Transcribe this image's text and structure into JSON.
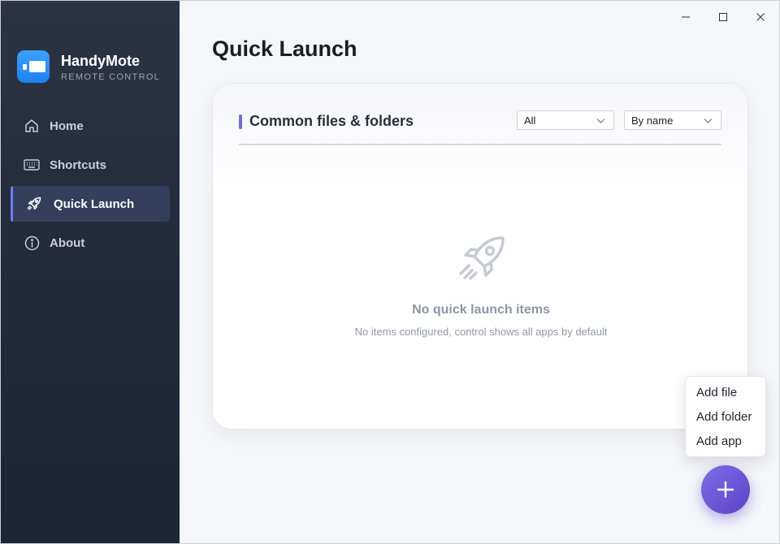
{
  "brand": {
    "name": "HandyMote",
    "subtitle": "REMOTE CONTROL",
    "icon": "remote-logo-icon",
    "accent": "#2a90f8"
  },
  "nav": {
    "items": [
      {
        "label": "Home",
        "icon": "home-icon",
        "active": false
      },
      {
        "label": "Shortcuts",
        "icon": "keyboard-icon",
        "active": false
      },
      {
        "label": "Quick Launch",
        "icon": "rocket-icon",
        "active": true
      },
      {
        "label": "About",
        "icon": "info-icon",
        "active": false
      }
    ]
  },
  "window_controls": [
    "minimize-icon",
    "maximize-icon",
    "close-icon"
  ],
  "page": {
    "title": "Quick Launch"
  },
  "card": {
    "title": "Common files & folders",
    "filter_select": {
      "value": "All"
    },
    "sort_select": {
      "value": "By name"
    },
    "empty_state": {
      "icon": "rocket-icon",
      "title": "No quick launch items",
      "description": "No items configured, control shows all apps by default"
    }
  },
  "context_menu": {
    "items": [
      "Add file",
      "Add folder",
      "Add app"
    ]
  },
  "fab": {
    "icon": "plus-icon",
    "color": "#6a53d4"
  }
}
